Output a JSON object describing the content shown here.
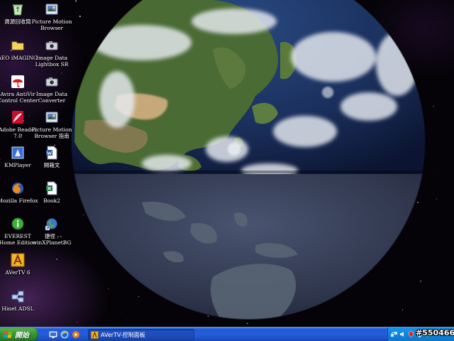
{
  "desktop": {
    "wallpaper": "globe-earth-east-asia",
    "icons": [
      {
        "label": "資源回收筒",
        "icon": "recycle-bin-icon"
      },
      {
        "label": "Picture Motion\nBrowser",
        "icon": "picture-motion-icon"
      },
      {
        "label": "nEO iMAGING",
        "icon": "folder-icon"
      },
      {
        "label": "Image Data\nLightbox SR",
        "icon": "camera-icon"
      },
      {
        "label": "Avira AntiVir\nControl Center",
        "icon": "umbrella-icon"
      },
      {
        "label": "Image Data\nConverter",
        "icon": "camera-icon"
      },
      {
        "label": "Adobe Reader\n7.0",
        "icon": "adobe-reader-icon"
      },
      {
        "label": "Picture Motion\nBrowser 指南",
        "icon": "picture-motion-icon"
      },
      {
        "label": "KMPlayer",
        "icon": "kmplayer-icon"
      },
      {
        "label": "開箱文",
        "icon": "word-document-icon"
      },
      {
        "label": "Mozilla Firefox",
        "icon": "firefox-icon"
      },
      {
        "label": "Book2",
        "icon": "excel-workbook-icon"
      },
      {
        "label": "EVEREST\nHome Edition",
        "icon": "everest-icon"
      },
      {
        "label": "捷徑 -\nwinXPlanetBG",
        "icon": "globe-shortcut-icon"
      },
      {
        "label": "AVerTV 6",
        "icon": "avertv-icon"
      },
      {
        "label": "Hinet ADSL",
        "icon": "network-icon"
      }
    ]
  },
  "taskbar": {
    "start_label": "開始",
    "quick_launch": [
      "show-desktop-icon",
      "internet-explorer-icon",
      "media-player-icon"
    ],
    "task_button_label": "AVerTV-控制面板",
    "tray_icons": [
      "network-tray-icon",
      "volume-tray-icon",
      "shield-tray-icon",
      "display-tray-icon",
      "chat-tray-icon"
    ]
  },
  "watermark": "#550466",
  "colors": {
    "taskbar_blue": "#245edb",
    "start_green": "#3c9a38",
    "tray_blue": "#0f83dc"
  }
}
